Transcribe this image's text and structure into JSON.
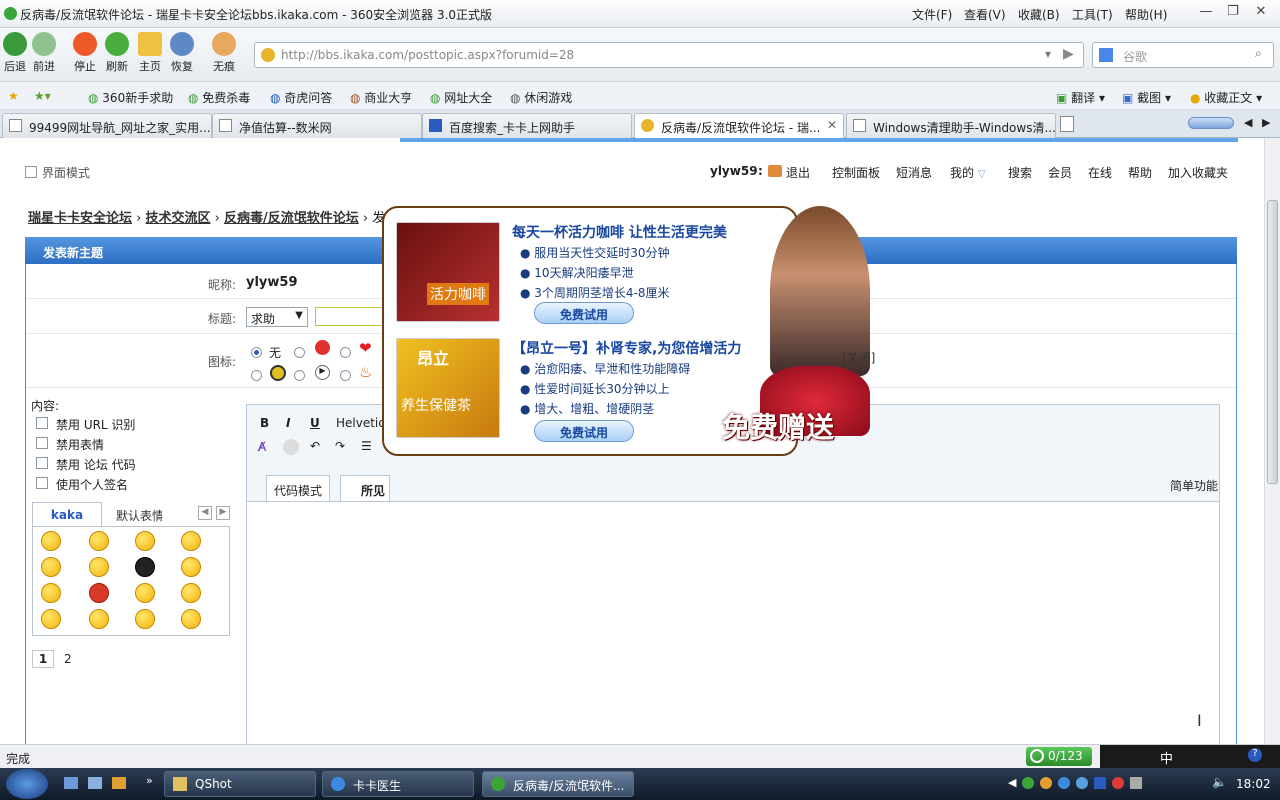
{
  "window": {
    "title": "反病毒/反流氓软件论坛 - 瑞星卡卡安全论坛bbs.ikaka.com - 360安全浏览器 3.0正式版",
    "menu": [
      "文件(F)",
      "查看(V)",
      "收藏(B)",
      "工具(T)",
      "帮助(H)"
    ]
  },
  "toolbar": {
    "back": "后退",
    "forward": "前进",
    "stop": "停止",
    "refresh": "刷新",
    "home": "主页",
    "restore": "恢复",
    "notrace": "无痕",
    "url": "http://bbs.ikaka.com/posttopic.aspx?forumid=28",
    "search_placeholder": "谷歌"
  },
  "favorites": [
    "360新手求助",
    "免费杀毒",
    "奇虎问答",
    "商业大亨",
    "网址大全",
    "休闲游戏"
  ],
  "favorites_right": [
    "翻译",
    "截图",
    "收藏正文"
  ],
  "tabs": [
    "99499网址导航_网址之家_实用...",
    "净值估算--数米网",
    "百度搜索_卡卡上网助手",
    "反病毒/反流氓软件论坛 - 瑞...",
    "Windows清理助手-Windows清..."
  ],
  "top": {
    "mode": "界面模式",
    "user": "ylyw59",
    "logout": "退出",
    "links": [
      "控制面板",
      "短消息",
      "我的",
      "搜索",
      "会员",
      "在线",
      "帮助",
      "加入收藏夹"
    ]
  },
  "breadcrumb": [
    "瑞星卡卡安全论坛",
    "技术交流区",
    "反病毒/反流氓软件论坛",
    "发表新主题"
  ],
  "form": {
    "heading": "发表新主题",
    "nick_label": "昵称:",
    "nick": "ylyw59",
    "title_label": "标题:",
    "title_type": "求助",
    "icon_label": "图标:",
    "icon_none": "无",
    "content_label": "内容:",
    "options": [
      "禁用 URL 识别",
      "禁用表情",
      "禁用 论坛 代码",
      "使用个人签名"
    ],
    "emoticon_tabs": [
      "kaka",
      "默认表情"
    ],
    "pages": [
      "1",
      "2"
    ],
    "font": "Helvetica",
    "editor_tabs": [
      "代码模式",
      "所见"
    ],
    "simple": "简单功能"
  },
  "ad": {
    "close": "[关闭]",
    "p1_title": "每天一杯活力咖啡 让性生活更完美",
    "p1_items": [
      "服用当天性交延时30分钟",
      "10天解决阳痿早泄",
      "3个周期阴茎增长4-8厘米"
    ],
    "p1_img": "活力咖啡",
    "p2_title": "【昂立一号】补肾专家,为您倍增活力",
    "p2_items": [
      "治愈阳痿、早泄和性功能障碍",
      "性爱时间延长30分钟以上",
      "增大、增粗、增硬阴茎"
    ],
    "p2_img": "养生保健茶",
    "p2_brand": "昂立",
    "trial": "免费试用",
    "banner": "免费赠送"
  },
  "status": {
    "text": "完成",
    "counter": "0/123"
  },
  "taskbar": {
    "tasks": [
      "QShot",
      "卡卡医生",
      "反病毒/反流氓软件..."
    ],
    "ime": "中",
    "time": "18:02"
  }
}
